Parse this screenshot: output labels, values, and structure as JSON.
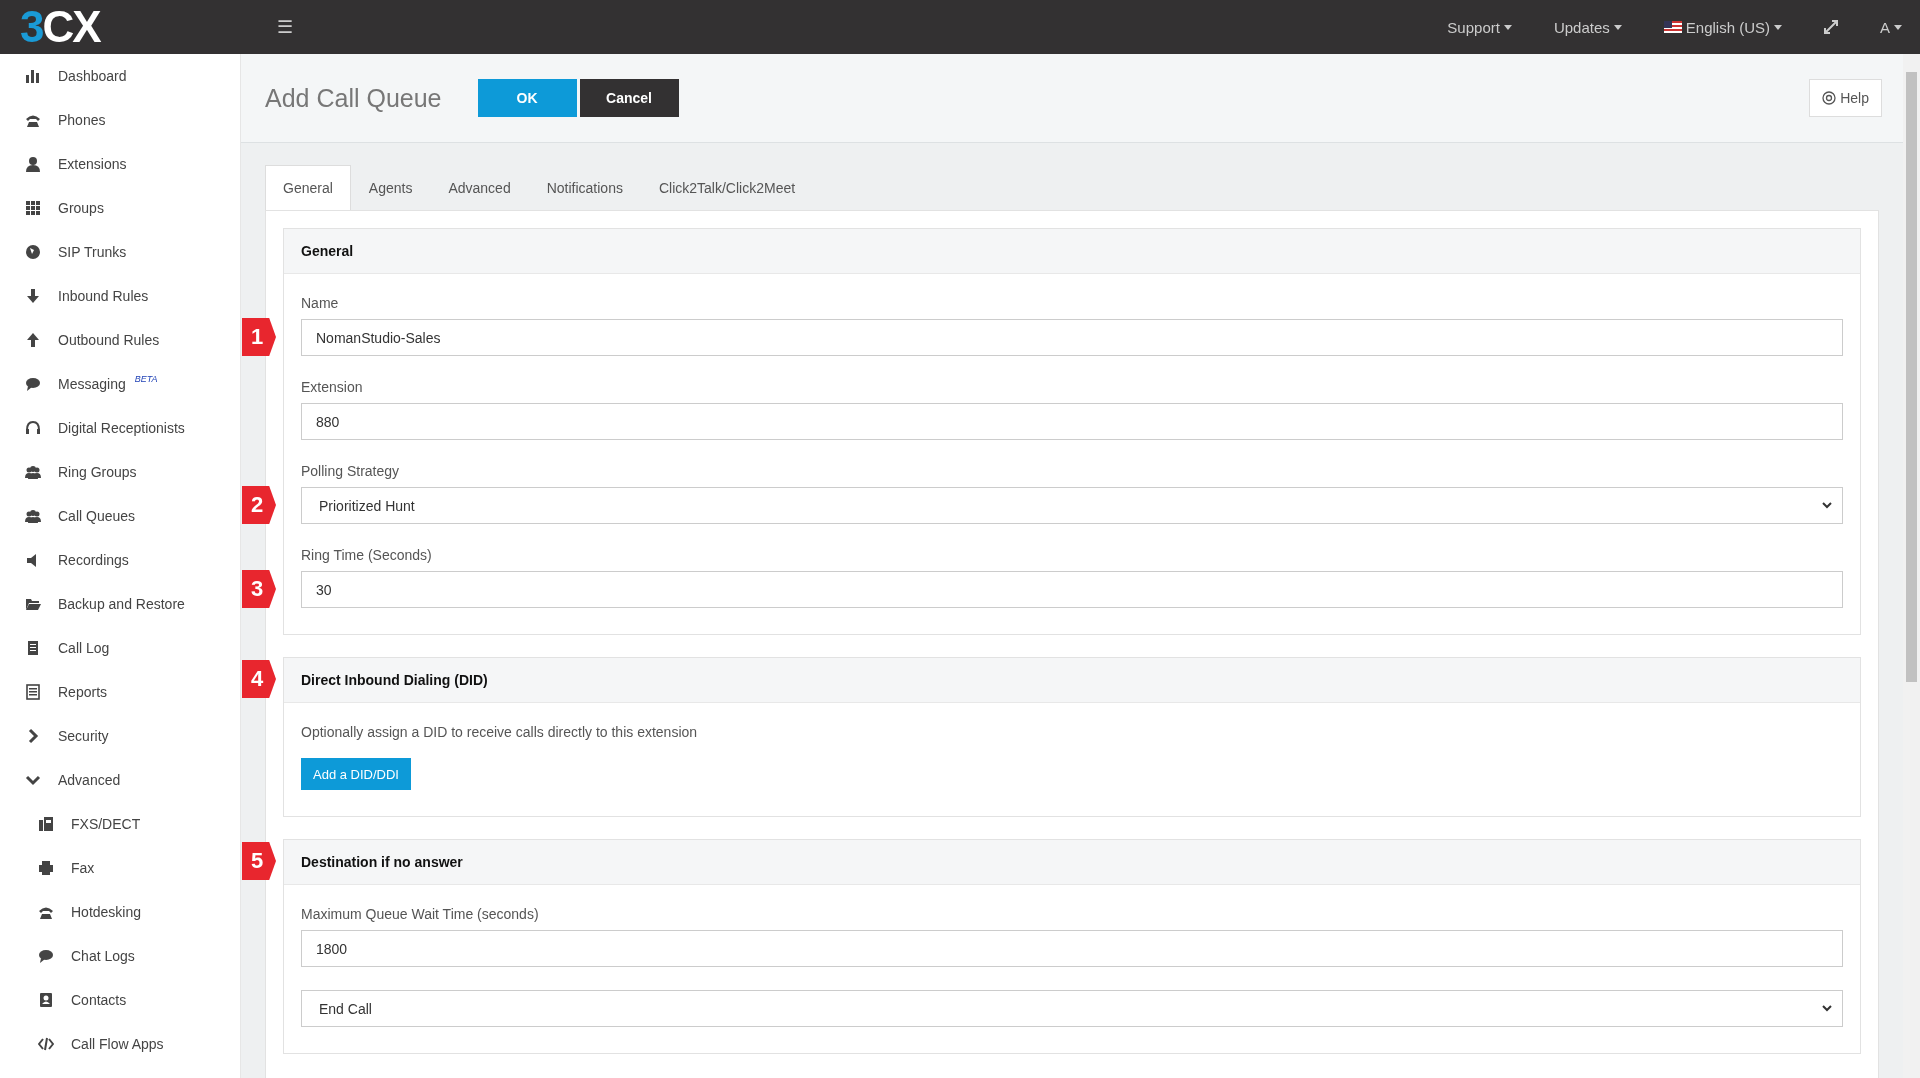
{
  "topbar": {
    "logo": "3CX",
    "menu_icon": "☰",
    "menus": [
      {
        "label": "Support",
        "kind": "dropdown"
      },
      {
        "label": "Updates",
        "kind": "dropdown"
      },
      {
        "label": "English (US)",
        "kind": "language"
      }
    ],
    "user": "A"
  },
  "sidebar": {
    "items": [
      {
        "label": "Dashboard"
      },
      {
        "label": "Phones"
      },
      {
        "label": "Extensions"
      },
      {
        "label": "Groups"
      },
      {
        "label": "SIP Trunks"
      },
      {
        "label": "Inbound Rules"
      },
      {
        "label": "Outbound Rules"
      },
      {
        "label": "Messaging",
        "badge": "BETA"
      },
      {
        "label": "Digital Receptionists"
      },
      {
        "label": "Ring Groups"
      },
      {
        "label": "Call Queues"
      },
      {
        "label": "Recordings"
      },
      {
        "label": "Backup and Restore"
      },
      {
        "label": "Call Log"
      },
      {
        "label": "Reports"
      },
      {
        "label": "Security",
        "expanded": false
      },
      {
        "label": "Advanced",
        "expanded": true,
        "children": [
          {
            "label": "FXS/DECT"
          },
          {
            "label": "Fax"
          },
          {
            "label": "Hotdesking"
          },
          {
            "label": "Chat Logs"
          },
          {
            "label": "Contacts"
          },
          {
            "label": "Call Flow Apps"
          }
        ]
      }
    ]
  },
  "page": {
    "title": "Add Call Queue",
    "buttons": [
      {
        "label": "OK",
        "kind": "primary"
      },
      {
        "label": "Cancel",
        "kind": "dark"
      }
    ],
    "help": "Help"
  },
  "tabs": [
    {
      "label": "General",
      "selected": true
    },
    {
      "label": "Agents",
      "selected": false
    },
    {
      "label": "Advanced",
      "selected": false
    },
    {
      "label": "Notifications",
      "selected": false
    },
    {
      "label": "Click2Talk/Click2Meet",
      "selected": false
    }
  ],
  "sections": [
    {
      "title": "General",
      "items": [
        {
          "kind": "text",
          "label": "Name",
          "value": "NomanStudio-Sales",
          "marker": "1"
        },
        {
          "kind": "text",
          "label": "Extension",
          "value": "880"
        },
        {
          "kind": "select",
          "label": "Polling Strategy",
          "value": "Prioritized Hunt",
          "marker": "2"
        },
        {
          "kind": "text",
          "label": "Ring Time (Seconds)",
          "value": "30",
          "marker": "3"
        }
      ]
    },
    {
      "title": "Direct Inbound Dialing (DID)",
      "marker": "4",
      "items": [
        {
          "kind": "note",
          "value": "Optionally assign a DID to receive calls directly to this extension"
        },
        {
          "kind": "button",
          "value": "Add a DID/DDI"
        }
      ]
    },
    {
      "title": "Destination if no answer",
      "marker": "5",
      "items": [
        {
          "kind": "text",
          "label": "Maximum Queue Wait Time (seconds)",
          "value": "1800"
        },
        {
          "kind": "select",
          "value": "End Call"
        }
      ]
    }
  ]
}
